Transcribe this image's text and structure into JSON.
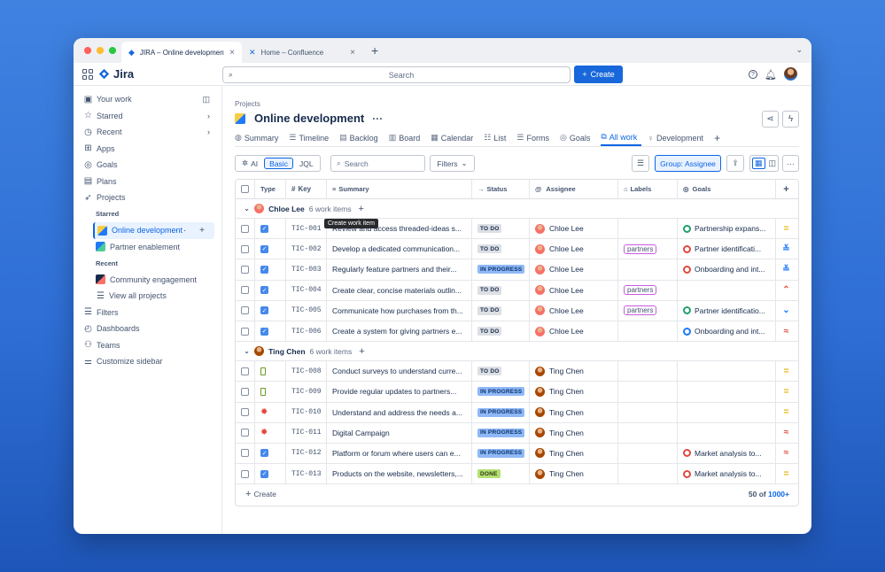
{
  "browser": {
    "tabs": [
      {
        "title": "JIRA – Online development",
        "icon": "jira-icon"
      },
      {
        "title": "Home – Confluence",
        "icon": "confluence-icon"
      }
    ]
  },
  "topnav": {
    "logo": "Jira",
    "search_placeholder": "Search",
    "create_label": "Create"
  },
  "sidebar": {
    "your_work": "Your work",
    "starred": "Starred",
    "recent": "Recent",
    "apps": "Apps",
    "goals": "Goals",
    "plans": "Plans",
    "projects": "Projects",
    "starred_heading": "Starred",
    "starred_items": [
      "Online development",
      "Partner enablement"
    ],
    "recent_heading": "Recent",
    "recent_items": [
      "Community engagement"
    ],
    "view_all": "View all projects",
    "filters": "Filters",
    "dashboards": "Dashboards",
    "teams": "Teams",
    "customize": "Customize sidebar"
  },
  "project": {
    "breadcrumb": "Projects",
    "title": "Online development",
    "tabs": [
      "Summary",
      "Timeline",
      "Backlog",
      "Board",
      "Calendar",
      "List",
      "Forms",
      "Goals",
      "All work",
      "Development"
    ]
  },
  "toolbar": {
    "ai": "AI",
    "basic": "Basic",
    "jql": "JQL",
    "search_placeholder": "Search",
    "filters": "Filters",
    "group_by": "Group: Assignee"
  },
  "table": {
    "columns": [
      "Type",
      "Key",
      "Summary",
      "Status",
      "Assignee",
      "Labels",
      "Goals"
    ],
    "groups": [
      {
        "name": "Chloe Lee",
        "count": "6 work items",
        "rows": [
          {
            "type": "task",
            "key": "TIC-001",
            "summary": "Review and access threaded-ideas s...",
            "status": "TO DO",
            "assignee": "Chloe Lee",
            "label": "",
            "goal": "Partnership expans...",
            "goal_color": "#22a06b",
            "priority": "medium"
          },
          {
            "type": "task",
            "key": "TIC-002",
            "summary": "Develop a dedicated communication...",
            "status": "TO DO",
            "assignee": "Chloe Lee",
            "label": "partners",
            "goal": "Partner identificati...",
            "goal_color": "#e2483d",
            "priority": "lowest"
          },
          {
            "type": "task",
            "key": "TIC-003",
            "summary": "Regularly feature partners and their...",
            "status": "IN PROGRESS",
            "assignee": "Chloe Lee",
            "label": "",
            "goal": "Onboarding and int...",
            "goal_color": "#e2483d",
            "priority": "lowest"
          },
          {
            "type": "task",
            "key": "TIC-004",
            "summary": "Create clear, concise materials outlin...",
            "status": "TO DO",
            "assignee": "Chloe Lee",
            "label": "partners",
            "goal": "",
            "goal_color": "",
            "priority": "high"
          },
          {
            "type": "task",
            "key": "TIC-005",
            "summary": "Communicate how purchases from th...",
            "status": "TO DO",
            "assignee": "Chloe Lee",
            "label": "partners",
            "goal": "Partner identificatio...",
            "goal_color": "#22a06b",
            "priority": "low"
          },
          {
            "type": "task",
            "key": "TIC-006",
            "summary": "Create a system for giving partners e...",
            "status": "TO DO",
            "assignee": "Chloe Lee",
            "label": "",
            "goal": "Onboarding and int...",
            "goal_color": "#1d7afc",
            "priority": "highest"
          }
        ]
      },
      {
        "name": "Ting Chen",
        "count": "6 work items",
        "rows": [
          {
            "type": "story",
            "key": "TIC-008",
            "summary": "Conduct surveys to understand curre...",
            "status": "TO DO",
            "assignee": "Ting Chen",
            "label": "",
            "goal": "",
            "goal_color": "",
            "priority": "medium"
          },
          {
            "type": "story",
            "key": "TIC-009",
            "summary": "Provide regular updates to partners...",
            "status": "IN PROGRESS",
            "assignee": "Ting Chen",
            "label": "",
            "goal": "",
            "goal_color": "",
            "priority": "medium"
          },
          {
            "type": "bug",
            "key": "TIC-010",
            "summary": "Understand and address the needs a...",
            "status": "IN PROGRESS",
            "assignee": "Ting Chen",
            "label": "",
            "goal": "",
            "goal_color": "",
            "priority": "medium"
          },
          {
            "type": "bug",
            "key": "TIC-011",
            "summary": "Digital Campaign",
            "status": "IN PROGRESS",
            "assignee": "Ting Chen",
            "label": "",
            "goal": "",
            "goal_color": "",
            "priority": "highest"
          },
          {
            "type": "task",
            "key": "TIC-012",
            "summary": "Platform or forum where users can e...",
            "status": "IN PROGRESS",
            "assignee": "Ting Chen",
            "label": "",
            "goal": "Market analysis to...",
            "goal_color": "#e2483d",
            "priority": "highest"
          },
          {
            "type": "task",
            "key": "TIC-013",
            "summary": "Products on the website, newsletters,...",
            "status": "DONE",
            "assignee": "Ting Chen",
            "label": "",
            "goal": "Market analysis to...",
            "goal_color": "#e2483d",
            "priority": "medium"
          }
        ]
      }
    ],
    "footer_create": "Create",
    "footer_count": "50 of",
    "footer_total": "1000+",
    "tooltip": "Create work item"
  },
  "colors": {
    "brand": "#1868db",
    "accent": "#0c66e4"
  }
}
